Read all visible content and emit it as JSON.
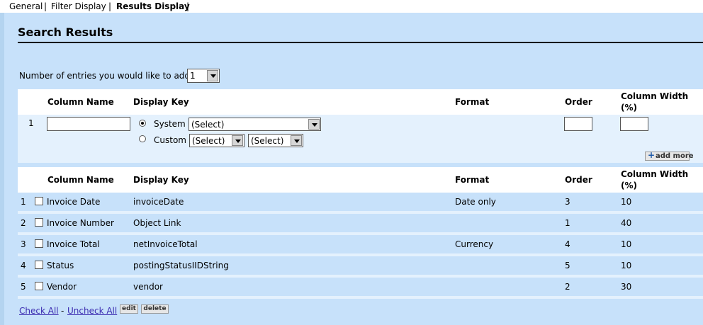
{
  "tabs": [
    {
      "label": "General"
    },
    {
      "label": "Filter Display"
    },
    {
      "label": "Results Display"
    }
  ],
  "tab_separator": "|",
  "title": "Search Results",
  "entries": {
    "label": "Number of entries you would like to add:",
    "selected": "1"
  },
  "headers": {
    "column_name": "Column Name",
    "display_key": "Display Key",
    "format": "Format",
    "order": "Order",
    "column_width": "Column Width",
    "column_width_unit": "(%)"
  },
  "add_row": {
    "index": "1",
    "column_name_value": "",
    "system_label": "System",
    "custom_label": "Custom",
    "system_select": "(Select)",
    "custom_select_1": "(Select)",
    "custom_select_2": "(Select)",
    "order_value": "",
    "width_value": "",
    "add_more_label": "add more"
  },
  "rows": [
    {
      "index": "1",
      "column_name": "Invoice Date",
      "display_key": "invoiceDate",
      "format": "Date only",
      "order": "3",
      "width": "10"
    },
    {
      "index": "2",
      "column_name": "Invoice Number",
      "display_key": "Object Link",
      "format": "",
      "order": "1",
      "width": "40"
    },
    {
      "index": "3",
      "column_name": "Invoice Total",
      "display_key": "netInvoiceTotal",
      "format": "Currency",
      "order": "4",
      "width": "10"
    },
    {
      "index": "4",
      "column_name": "Status",
      "display_key": "postingStatusIIDString",
      "format": "",
      "order": "5",
      "width": "10"
    },
    {
      "index": "5",
      "column_name": "Vendor",
      "display_key": "vendor",
      "format": "",
      "order": "2",
      "width": "30"
    }
  ],
  "footer": {
    "check_all": "Check All",
    "separator": "-",
    "uncheck_all": "Uncheck All",
    "edit": "edit",
    "delete": "delete"
  }
}
